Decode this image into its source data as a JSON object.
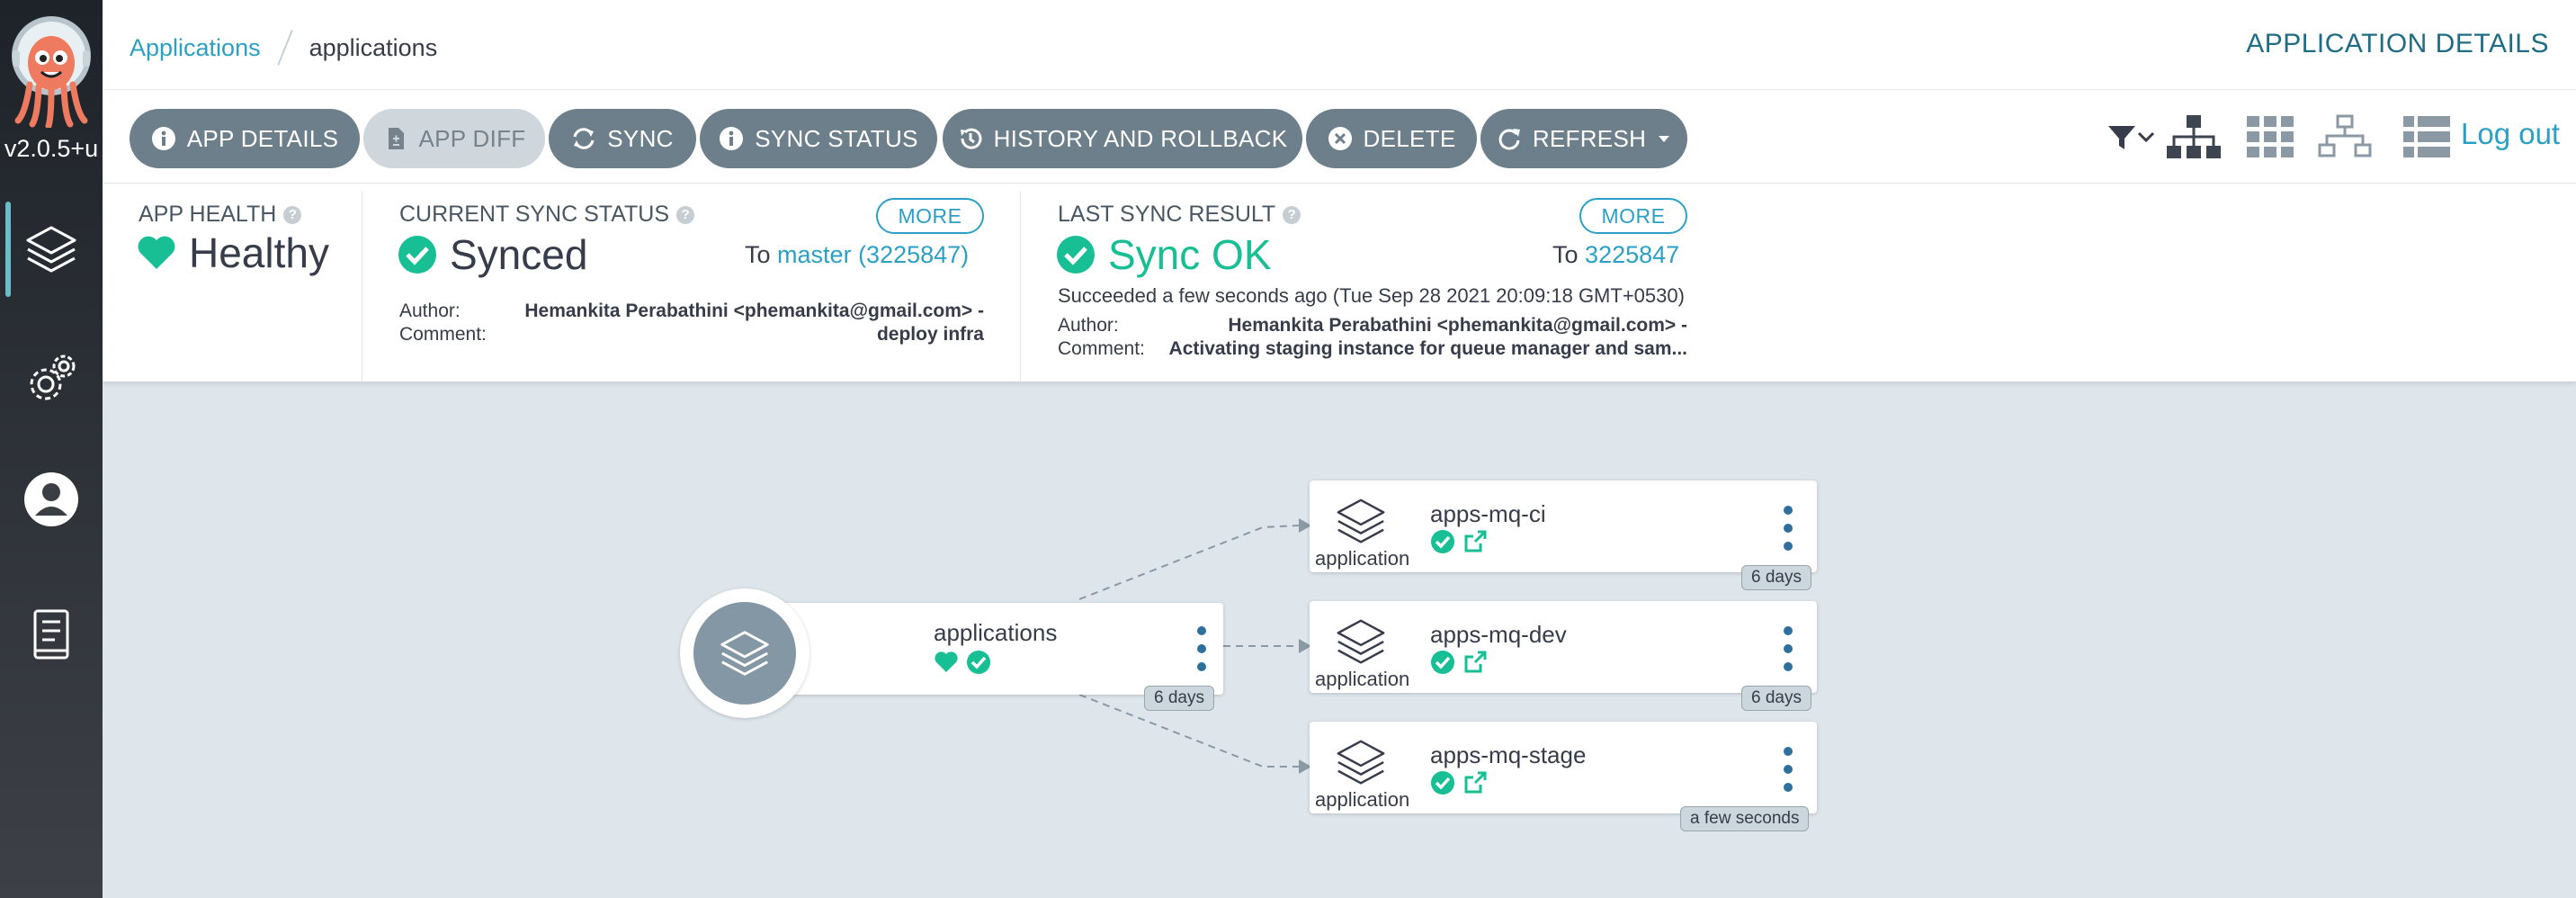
{
  "sidebar": {
    "version": "v2.0.5+u",
    "items": [
      "applications-icon",
      "settings-icon",
      "user-icon",
      "docs-icon"
    ]
  },
  "header": {
    "breadcrumb_root": "Applications",
    "breadcrumb_current": "applications",
    "title": "APPLICATION DETAILS"
  },
  "toolbar": {
    "app_details": "APP DETAILS",
    "app_diff": "APP DIFF",
    "sync": "SYNC",
    "sync_status": "SYNC STATUS",
    "history": "HISTORY AND ROLLBACK",
    "delete": "DELETE",
    "refresh": "REFRESH",
    "logout": "Log out"
  },
  "status": {
    "health_label": "APP HEALTH",
    "health_value": "Healthy",
    "sync_label": "CURRENT SYNC STATUS",
    "sync_more": "MORE",
    "sync_value": "Synced",
    "sync_to_prefix": "To",
    "sync_to_rev": "master (3225847)",
    "author_label": "Author:",
    "author_value": "Hemankita Perabathini <phemankita@gmail.com> -",
    "comment_label": "Comment:",
    "comment_value": "deploy infra",
    "last_label": "LAST SYNC RESULT",
    "last_more": "MORE",
    "last_value": "Sync OK",
    "last_to_prefix": "To",
    "last_to_rev": "3225847",
    "last_succeeded": "Succeeded a few seconds ago (Tue Sep 28 2021 20:09:18 GMT+0530)",
    "last_author_label": "Author:",
    "last_author_value": "Hemankita Perabathini <phemankita@gmail.com> -",
    "last_comment_label": "Comment:",
    "last_comment_value": "Activating staging instance for queue manager and sam..."
  },
  "graph": {
    "root": {
      "name": "applications",
      "age": "6 days"
    },
    "children": [
      {
        "name": "apps-mq-ci",
        "kind": "application",
        "age": "6 days"
      },
      {
        "name": "apps-mq-dev",
        "kind": "application",
        "age": "6 days"
      },
      {
        "name": "apps-mq-stage",
        "kind": "application",
        "age": "a few seconds"
      }
    ]
  },
  "colors": {
    "accent": "#2ba0c4",
    "healthy": "#18be94",
    "button": "#6d7f8b",
    "graph_bg": "#dee6eb"
  }
}
